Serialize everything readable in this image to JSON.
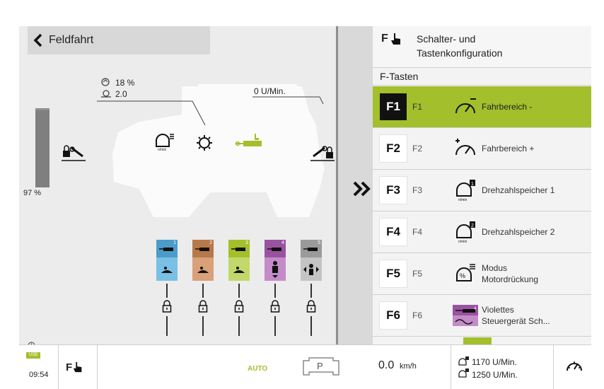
{
  "header": {
    "title": "Feldfahrt"
  },
  "left": {
    "pto_percent": "18 %",
    "pto_ratio": "2.0",
    "engine_speed": "0 U/Min.",
    "gauge_percent": "97 %",
    "gauge_level": 0.97,
    "valves": [
      {
        "num": "1",
        "color": "#4b9cc9"
      },
      {
        "num": "2",
        "color": "#b7784a"
      },
      {
        "num": "3",
        "color": "#a4bf2c"
      },
      {
        "num": "4",
        "color": "#9a52a0"
      },
      {
        "num": "5",
        "color": "#9a9a9a"
      }
    ]
  },
  "right": {
    "header": {
      "icon": "f-hand-icon",
      "title_line1": "Schalter- und",
      "title_line2": "Tastenkonfiguration"
    },
    "section": "F-Tasten",
    "rows": [
      {
        "key": "F1",
        "short": "F1",
        "icon": "speed-range-minus-icon",
        "line1": "Fahrbereich -",
        "line2": "",
        "selected": true
      },
      {
        "key": "F2",
        "short": "F2",
        "icon": "speed-range-plus-icon",
        "line1": "Fahrbereich +",
        "line2": ""
      },
      {
        "key": "F3",
        "short": "F3",
        "icon": "rpm-memory-1-icon",
        "line1": "Drehzahlspeicher 1",
        "line2": ""
      },
      {
        "key": "F4",
        "short": "F4",
        "icon": "rpm-memory-2-icon",
        "line1": "Drehzahlspeicher 2",
        "line2": ""
      },
      {
        "key": "F5",
        "short": "F5",
        "icon": "engine-droop-mode-icon",
        "line1": "Modus",
        "line2": "Motordrückung"
      },
      {
        "key": "F6",
        "short": "F6",
        "icon": "violet-valve-icon",
        "line1": "Violettes",
        "line2": "Steuergerät Sch..."
      }
    ]
  },
  "bottom": {
    "time": "09:54",
    "usb": "USB",
    "auto": "AUTO",
    "park": "P",
    "speed_value": "0.0",
    "speed_unit": "km/h",
    "rpm1": "1170 U/Min.",
    "rpm2": "1250 U/Min."
  }
}
